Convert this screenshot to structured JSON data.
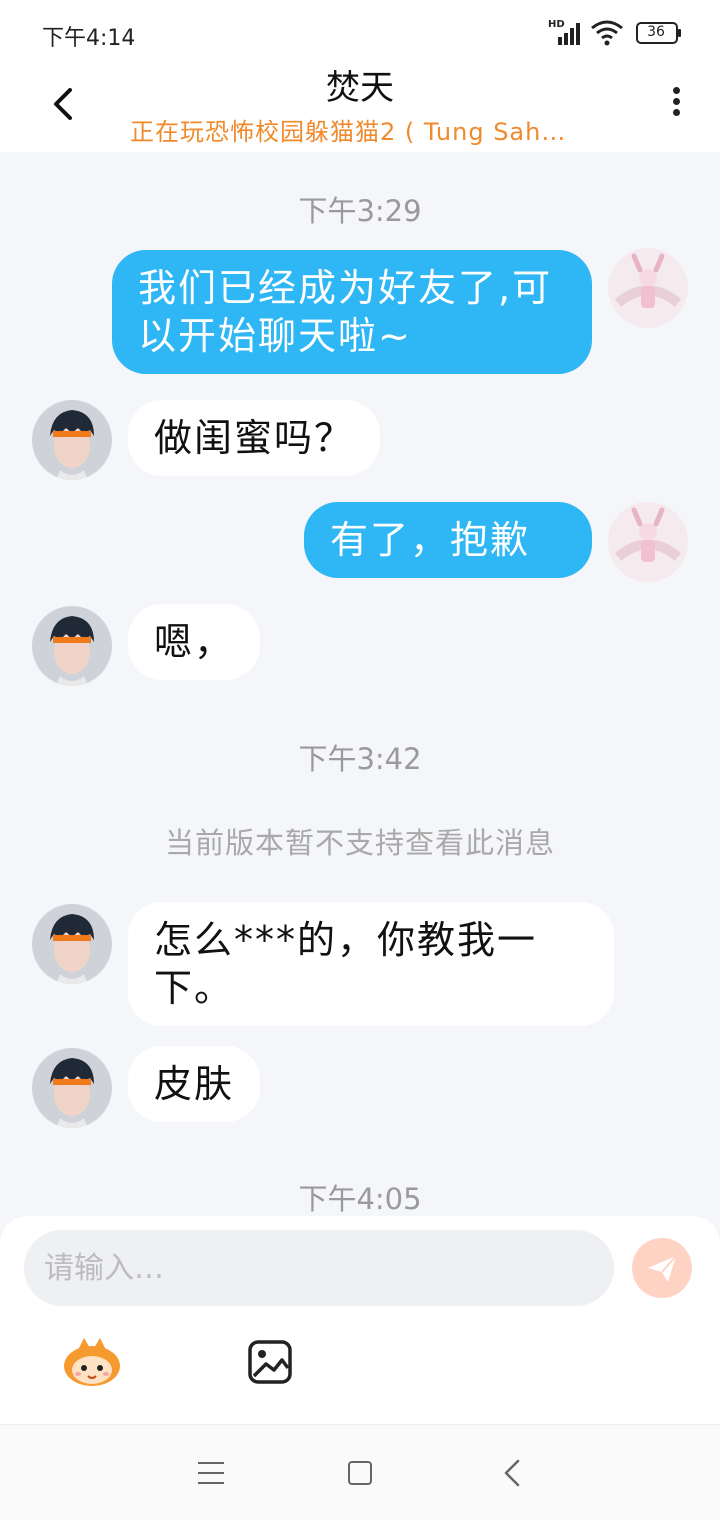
{
  "status_bar": {
    "time": "下午4:14",
    "network_label": "HD",
    "battery": "36"
  },
  "header": {
    "title": "焚天",
    "subtitle": "正在玩恐怖校园躲猫猫2 ( Tung Sah…"
  },
  "messages": [
    {
      "kind": "time",
      "text": "下午3:29"
    },
    {
      "kind": "bubble",
      "sender": "me",
      "text": "我们已经成为好友了,可以开始聊天啦~"
    },
    {
      "kind": "bubble",
      "sender": "other",
      "text": "做闺蜜吗？"
    },
    {
      "kind": "bubble",
      "sender": "me",
      "text": "有了，抱歉"
    },
    {
      "kind": "bubble",
      "sender": "other",
      "text": "嗯，"
    },
    {
      "kind": "time",
      "text": "下午3:42"
    },
    {
      "kind": "notice",
      "text": "当前版本暂不支持查看此消息"
    },
    {
      "kind": "bubble",
      "sender": "other",
      "text": "怎么***的，你教我一下。"
    },
    {
      "kind": "bubble",
      "sender": "other",
      "text": "皮肤"
    },
    {
      "kind": "time",
      "text": "下午4:05"
    }
  ],
  "input": {
    "placeholder": "请输入…"
  },
  "icons": {
    "back": "chevron-left-icon",
    "more": "more-vertical-icon",
    "send": "send-icon",
    "emoji": "mascot-emoji-icon",
    "image": "image-icon",
    "nav_menu": "menu-icon",
    "nav_home": "home-square-icon",
    "nav_back": "back-icon"
  },
  "colors": {
    "my_bubble": "#2eb6f5",
    "other_bubble": "#ffffff",
    "subtitle": "#f08a2c",
    "send_button": "#ffd3c4"
  }
}
